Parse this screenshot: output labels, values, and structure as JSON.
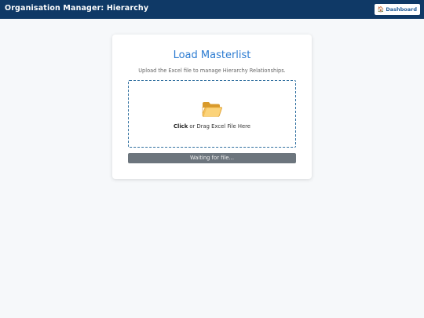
{
  "header": {
    "title": "Organisation Manager: Hierarchy",
    "dashboard_icon": "home-icon",
    "dashboard_label": "Dashboard"
  },
  "card": {
    "title": "Load Masterlist",
    "subtitle": "Upload the Excel file to manage Hierarchy Relationships.",
    "dropzone": {
      "icon": "open-folder-icon",
      "action_bold": "Click",
      "action_rest": " or Drag Excel File Here"
    },
    "status": "Waiting for file..."
  },
  "colors": {
    "header_bg": "#0f3966",
    "accent_blue": "#2b7bd1",
    "status_bg": "#6c757d",
    "page_bg": "#f6f8fa"
  }
}
